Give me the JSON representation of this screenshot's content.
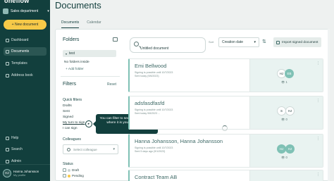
{
  "sidebar": {
    "brand": "oneflow",
    "org": "Sales department",
    "new_document": "+ New document",
    "nav": [
      "Dashboard",
      "Documents",
      "Templates",
      "Address book"
    ],
    "bottom_nav": [
      "Help",
      "Search",
      "Admin"
    ],
    "user": {
      "initials": "HJ",
      "name": "Hanna Johansson",
      "sub": "My profile"
    }
  },
  "main": {
    "title": "Documents",
    "tabs": [
      "Documents",
      "Calendar"
    ]
  },
  "folders": {
    "title": "Folders",
    "selected": "test",
    "empty": "No folders inside",
    "add": "+ Add folder"
  },
  "filters": {
    "title": "Filters",
    "reset": "Reset",
    "quick_title": "Quick filters",
    "quick": [
      "Drafts",
      "Sent",
      "Signed",
      "My turn to sign",
      "I can sign"
    ],
    "colleagues_title": "Colleagues",
    "colleagues_placeholder": "Select colleague",
    "status_title": "Status",
    "status": [
      {
        "label": "Draft",
        "color": "#c9d3d2"
      },
      {
        "label": "Pending",
        "color": "#f7c948"
      }
    ]
  },
  "tooltip": "You can filter to see all the contracts where it is your turn to sign",
  "toolbar": {
    "search_value": "Untitled document",
    "sort_label": "Sort",
    "sort_value": "Creation date",
    "import": "Import signed document"
  },
  "documents": [
    {
      "title": "Emi Bellwood",
      "lines": [
        "Signing is possible until 10/7/2023",
        "Sent today (9/6/2023)"
      ],
      "views": "1",
      "signers": [
        "HJ",
        "EB"
      ]
    },
    {
      "title": "adsfasdfasfd",
      "lines": [
        "Signing is possible until 10/7/2023",
        "Sent today 9/6/2023 ..."
      ],
      "views": "0",
      "signers": [
        "S",
        "HJ"
      ]
    },
    {
      "title": "Hanna Johansson, Hanna Johansson",
      "lines": [
        "Signing is possible until 10/7/2023",
        "Sent 5 days ago (9/1/2023)"
      ],
      "views": "0",
      "signers": [
        "HJ",
        "HJ"
      ]
    },
    {
      "title": "Contract Team AB",
      "lines": [],
      "views": "",
      "signers": []
    }
  ]
}
